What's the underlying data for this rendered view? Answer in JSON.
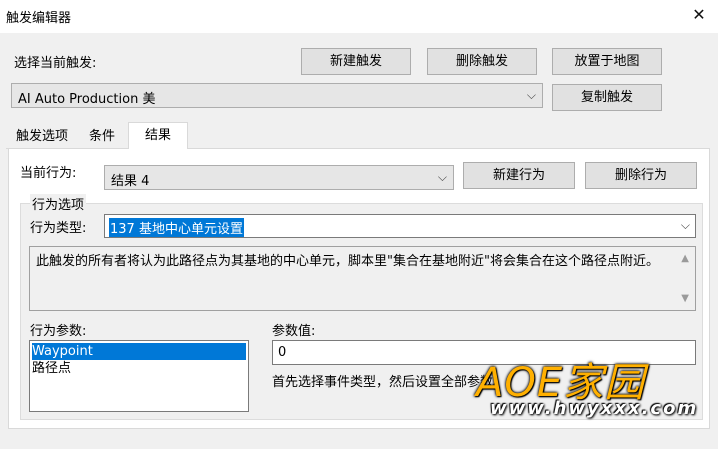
{
  "window": {
    "title": "触发编辑器",
    "close_glyph": "✕"
  },
  "trigger": {
    "select_label": "选择当前触发:",
    "selected": "AI Auto Production 美",
    "new_button": "新建触发",
    "delete_button": "删除触发",
    "place_button": "放置于地图",
    "copy_button": "复制触发"
  },
  "tabs": [
    {
      "label": "触发选项",
      "active": false
    },
    {
      "label": "条件",
      "active": false
    },
    {
      "label": "结果",
      "active": true
    }
  ],
  "result": {
    "current_label": "当前行为:",
    "current_value": "结果 4",
    "new_action_button": "新建行为",
    "delete_action_button": "删除行为",
    "options_group_label": "行为选项",
    "type_label": "行为类型:",
    "type_value": "137 基地中心单元设置",
    "description": "此触发的所有者将认为此路径点为其基地的中心单元，脚本里\"集合在基地附近\"将会集合在这个路径点附近。",
    "params_label": "行为参数:",
    "params": [
      "Waypoint",
      "路径点"
    ],
    "param_value_label": "参数值:",
    "param_value": "0",
    "hint": "首先选择事件类型，然后设置全部参数。"
  },
  "watermark": {
    "main": "AOE家园",
    "url": "www.hwyxxx.com"
  },
  "colors": {
    "selection": "#0078d7",
    "watermark": "#ffb000"
  }
}
